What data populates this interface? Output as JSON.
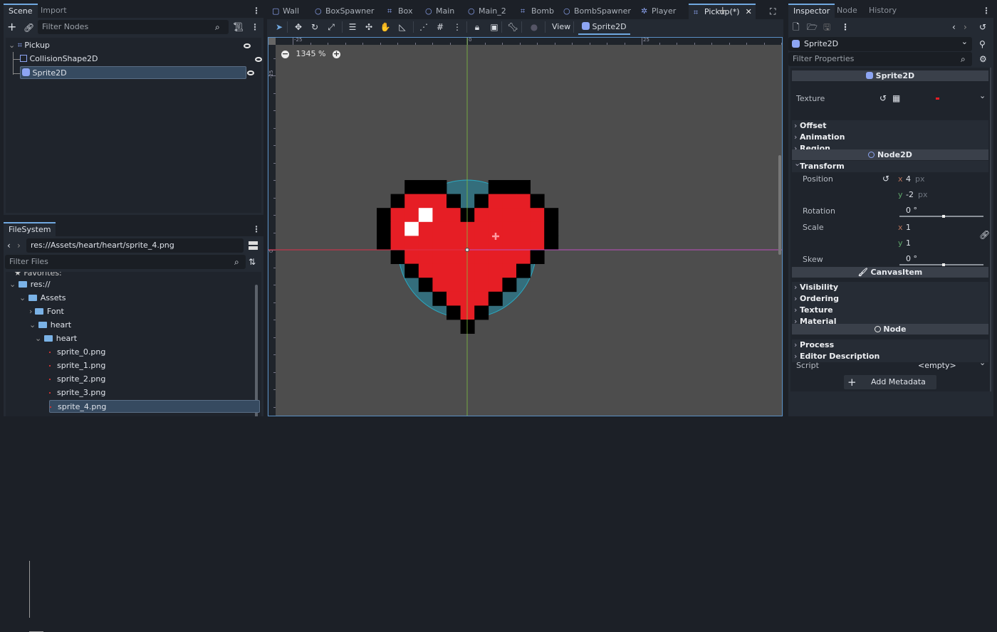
{
  "scene_dock": {
    "tabs": [
      "Scene",
      "Import"
    ],
    "filter_placeholder": "Filter Nodes",
    "nodes": [
      {
        "name": "Pickup",
        "icon": "area2d-icon"
      },
      {
        "name": "CollisionShape2D",
        "icon": "collision-shape-icon"
      },
      {
        "name": "Sprite2D",
        "icon": "sprite2d-icon",
        "selected": true
      }
    ]
  },
  "filesystem": {
    "tab": "FileSystem",
    "path": "res://Assets/heart/heart/sprite_4.png",
    "filter_placeholder": "Filter Files",
    "favorites": "Favorites:",
    "tree": [
      {
        "name": "res://",
        "type": "folder"
      },
      {
        "name": "Assets",
        "type": "folder"
      },
      {
        "name": "Font",
        "type": "folder"
      },
      {
        "name": "heart",
        "type": "folder"
      },
      {
        "name": "heart",
        "type": "folder"
      },
      {
        "name": "sprite_0.png",
        "type": "file"
      },
      {
        "name": "sprite_1.png",
        "type": "file"
      },
      {
        "name": "sprite_2.png",
        "type": "file"
      },
      {
        "name": "sprite_3.png",
        "type": "file"
      },
      {
        "name": "sprite_4.png",
        "type": "file",
        "selected": true
      }
    ]
  },
  "editor": {
    "tabs": [
      {
        "label": "Wall",
        "icon": "scene-icon"
      },
      {
        "label": "BoxSpawner",
        "icon": "node-icon"
      },
      {
        "label": "Box",
        "icon": "area2d-icon"
      },
      {
        "label": "Main",
        "icon": "node-icon"
      },
      {
        "label": "Main_2",
        "icon": "node-icon"
      },
      {
        "label": "Bomb",
        "icon": "area2d-icon"
      },
      {
        "label": "BombSpawner",
        "icon": "node-icon"
      },
      {
        "label": "Player",
        "icon": "character-icon"
      },
      {
        "label": "Pickup(*)",
        "icon": "area2d-icon",
        "active": true
      }
    ],
    "view_label": "View",
    "selected_node": "Sprite2D",
    "zoom": "1345 %",
    "ruler": {
      "top": [
        "-25",
        "0",
        "25"
      ],
      "left": [
        "-25",
        "0"
      ]
    }
  },
  "inspector": {
    "tabs": [
      "Inspector",
      "Node",
      "History"
    ],
    "object": "Sprite2D",
    "filter_placeholder": "Filter Properties",
    "sections": {
      "sprite2d": "Sprite2D",
      "node2d": "Node2D",
      "canvasitem": "CanvasItem",
      "node": "Node"
    },
    "texture_label": "Texture",
    "groups1": [
      "Offset",
      "Animation",
      "Region"
    ],
    "transform": "Transform",
    "position": {
      "label": "Position",
      "x": "4",
      "y": "-2",
      "unit": "px"
    },
    "rotation": {
      "label": "Rotation",
      "value": "0 °"
    },
    "scale": {
      "label": "Scale",
      "x": "1",
      "y": "1"
    },
    "skew": {
      "label": "Skew",
      "value": "0 °"
    },
    "groups2": [
      "Visibility",
      "Ordering",
      "Texture",
      "Material"
    ],
    "groups3": [
      "Process",
      "Editor Description"
    ],
    "script": {
      "label": "Script",
      "value": "<empty>"
    },
    "add_metadata": "Add Metadata",
    "axis_labels": {
      "x": "x",
      "y": "y"
    }
  },
  "colors": {
    "accent": "#70a8e0",
    "heart_red": "#e61e25",
    "collision": "#2c7a8c",
    "x_axis": "#e0304a",
    "y_axis": "#7fbf40"
  }
}
